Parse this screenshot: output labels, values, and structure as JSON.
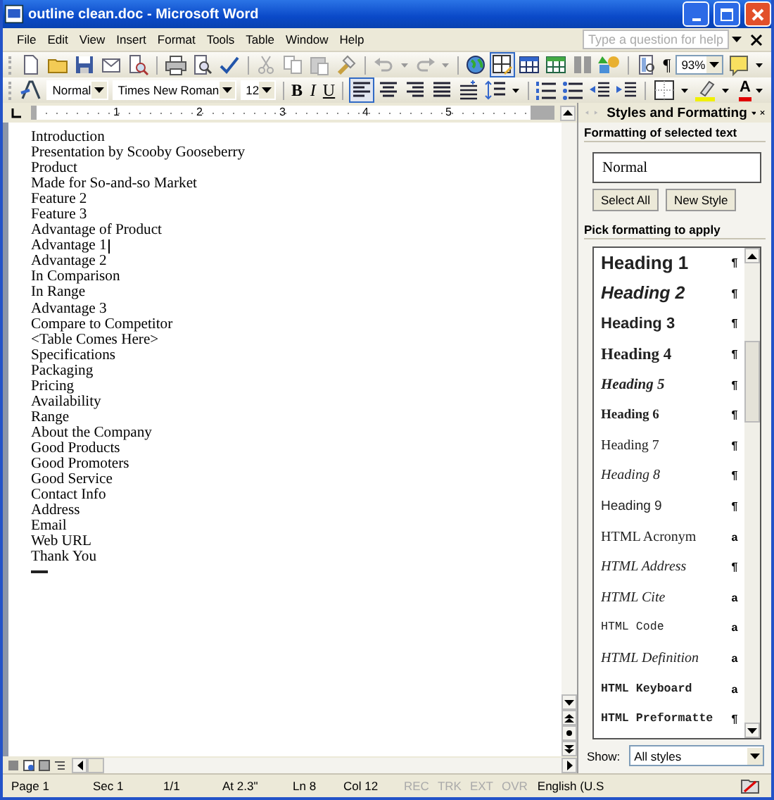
{
  "window": {
    "title": "outline clean.doc - Microsoft Word"
  },
  "menu": [
    "File",
    "Edit",
    "View",
    "Insert",
    "Format",
    "Tools",
    "Table",
    "Window",
    "Help"
  ],
  "help_box": {
    "placeholder": "Type a question for help"
  },
  "standard_toolbar": {
    "tables_and_borders": {
      "pressed": true
    },
    "show_hide": "¶",
    "zoom": "93%"
  },
  "formatting_toolbar": {
    "style": "Normal",
    "font": "Times New Roman",
    "size": "12",
    "bold": "B",
    "italic": "I",
    "underline": "U",
    "alignment": [
      {
        "selected": true
      },
      {
        "selected": false
      },
      {
        "selected": false
      },
      {
        "selected": false
      }
    ],
    "font_color_letter": "A"
  },
  "ruler": {
    "numbers": [
      "1",
      "2",
      "3",
      "4",
      "5"
    ]
  },
  "document": {
    "lines": [
      {
        "text": "Introduction",
        "cursor": false
      },
      {
        "text": "Presentation by Scooby Gooseberry",
        "cursor": false
      },
      {
        "text": "Product",
        "cursor": false
      },
      {
        "text": "Made for So-and-so Market",
        "cursor": false
      },
      {
        "text": "Feature 2",
        "cursor": false
      },
      {
        "text": "Feature 3",
        "cursor": false
      },
      {
        "text": "Advantage of Product",
        "cursor": false
      },
      {
        "text": "Advantage 1",
        "cursor": true
      },
      {
        "text": "Advantage 2",
        "cursor": false
      },
      {
        "text": "In Comparison",
        "cursor": false
      },
      {
        "text": "In Range",
        "cursor": false
      },
      {
        "text": "Advantage 3",
        "cursor": false
      },
      {
        "text": "Compare to Competitor",
        "cursor": false
      },
      {
        "text": "<Table Comes Here>",
        "cursor": false
      },
      {
        "text": "Specifications",
        "cursor": false
      },
      {
        "text": "Packaging",
        "cursor": false
      },
      {
        "text": "Pricing",
        "cursor": false
      },
      {
        "text": "Availability",
        "cursor": false
      },
      {
        "text": "Range",
        "cursor": false
      },
      {
        "text": "About the Company",
        "cursor": false
      },
      {
        "text": "Good Products",
        "cursor": false
      },
      {
        "text": "Good Promoters",
        "cursor": false
      },
      {
        "text": "Good Service",
        "cursor": false
      },
      {
        "text": "Contact Info",
        "cursor": false
      },
      {
        "text": "Address",
        "cursor": false
      },
      {
        "text": "Email",
        "cursor": false
      },
      {
        "text": "Web URL",
        "cursor": false
      },
      {
        "text": "Thank You",
        "cursor": false
      }
    ]
  },
  "task_pane": {
    "title": "Styles and Formatting",
    "selected_heading": "Formatting of selected text",
    "selected_style": "Normal",
    "buttons": [
      "Select All",
      "New Style"
    ],
    "pick_heading": "Pick formatting to apply",
    "styles": [
      {
        "name": "Heading 1",
        "mark": "¶"
      },
      {
        "name": "Heading 2",
        "mark": "¶"
      },
      {
        "name": "Heading 3",
        "mark": "¶"
      },
      {
        "name": "Heading 4",
        "mark": "¶"
      },
      {
        "name": "Heading 5",
        "mark": "¶"
      },
      {
        "name": "Heading 6",
        "mark": "¶"
      },
      {
        "name": "Heading 7",
        "mark": "¶"
      },
      {
        "name": "Heading 8",
        "mark": "¶"
      },
      {
        "name": "Heading 9",
        "mark": "¶"
      },
      {
        "name": "HTML Acronym",
        "mark": "a"
      },
      {
        "name": "HTML Address",
        "mark": "¶"
      },
      {
        "name": "HTML Cite",
        "mark": "a"
      },
      {
        "name": "HTML Code",
        "mark": "a"
      },
      {
        "name": "HTML Definition",
        "mark": "a"
      },
      {
        "name": "HTML Keyboard",
        "mark": "a"
      },
      {
        "name": "HTML Preformatte",
        "mark": "¶"
      }
    ],
    "show_label": "Show:",
    "show_value": "All styles"
  },
  "status_bar": [
    {
      "text": "Page 1",
      "disabled": false
    },
    {
      "text": "Sec 1",
      "disabled": false
    },
    {
      "text": "1/1",
      "disabled": false
    },
    {
      "text": "At 2.3\"",
      "disabled": false
    },
    {
      "text": "Ln 8",
      "disabled": false
    },
    {
      "text": "Col 12",
      "disabled": false
    },
    {
      "text": "REC",
      "disabled": true
    },
    {
      "text": "TRK",
      "disabled": true
    },
    {
      "text": "EXT",
      "disabled": true
    },
    {
      "text": "OVR",
      "disabled": true
    },
    {
      "text": "English (U.S",
      "disabled": false
    }
  ]
}
